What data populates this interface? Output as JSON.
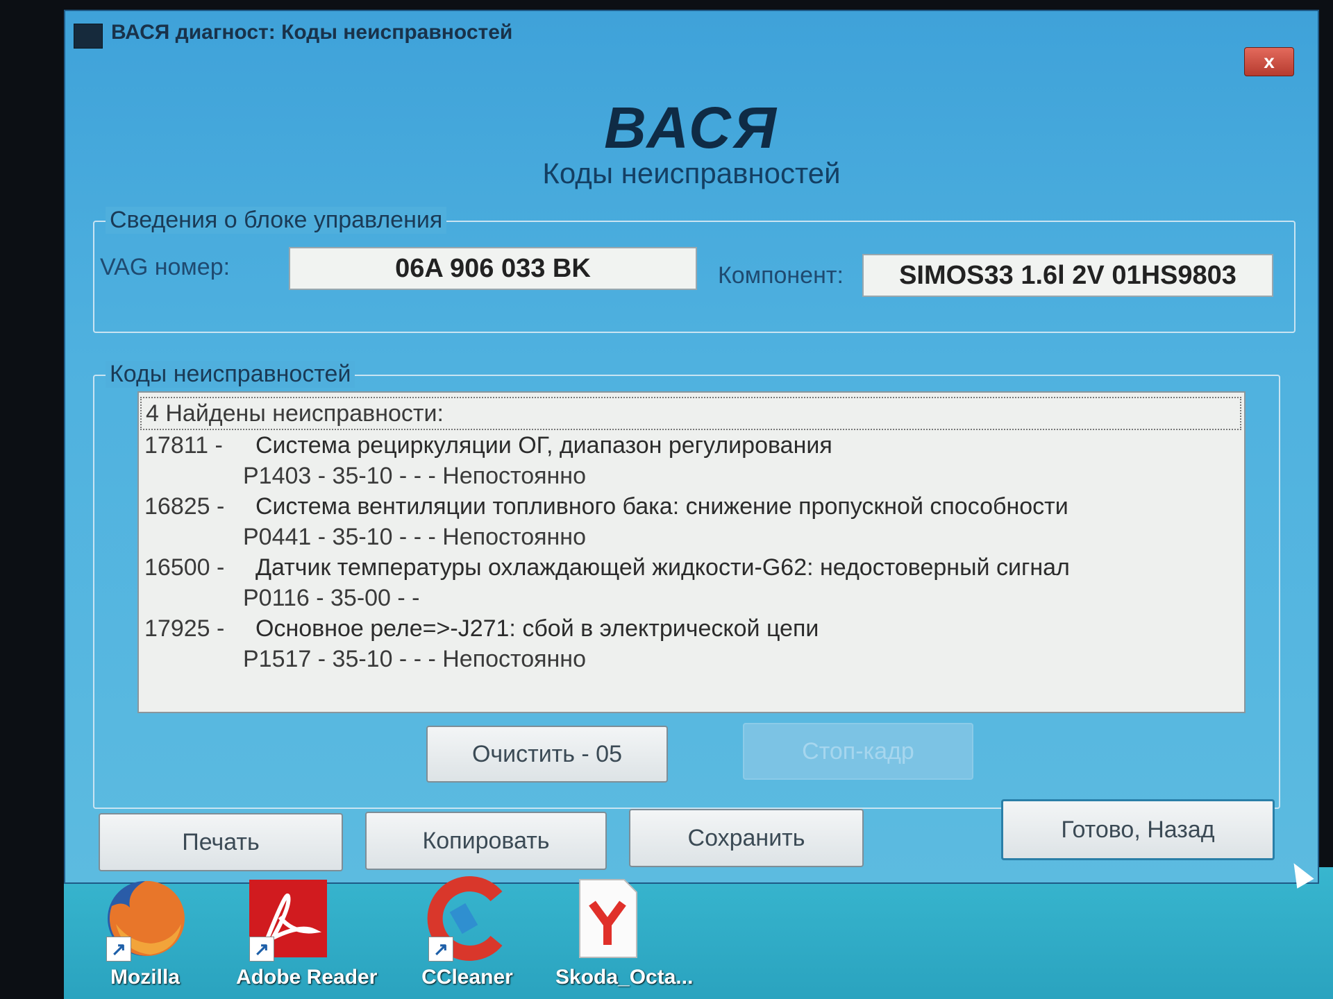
{
  "window": {
    "title": "ВАСЯ диагност: Коды неисправностей",
    "close_label": "x",
    "brand": "ВАСЯ",
    "subtitle": "Коды неисправностей"
  },
  "ecu_info": {
    "legend": "Сведения о блоке управления",
    "vag_label": "VAG номер:",
    "vag_value": "06A 906 033 BK",
    "component_label": "Компонент:",
    "component_value": "SIMOS33 1.6l 2V 01HS9803"
  },
  "faults": {
    "legend": "Коды неисправностей",
    "header": "4 Найдены неисправности:",
    "items": [
      {
        "code": "17811 -",
        "description": "Система рециркуляции ОГ, диапазон регулирования",
        "detail": "P1403 - 35-10 -   - - Непостоянно"
      },
      {
        "code": "16825 -",
        "description": "Система вентиляции топливного бака: снижение пропускной способности",
        "detail": "P0441 - 35-10 -   - - Непостоянно"
      },
      {
        "code": "16500 -",
        "description": "Датчик температуры охлаждающей жидкости-G62: недостоверный сигнал",
        "detail": "P0116 - 35-00 -   -"
      },
      {
        "code": "17925 -",
        "description": "Основное реле=>-J271: сбой в электрической цепи",
        "detail": "P1517 - 35-10 -   - - Непостоянно"
      }
    ],
    "clear_button": "Очистить - 05",
    "freeze_frame_button": "Стоп-кадр"
  },
  "bottom_buttons": {
    "print": "Печать",
    "copy": "Копировать",
    "save": "Сохранить",
    "done": "Готово, Назад"
  },
  "desktop_icons": [
    {
      "label": "Mozilla",
      "icon": "firefox-icon"
    },
    {
      "label": "Adobe Reader",
      "icon": "adobe-reader-icon"
    },
    {
      "label": "CCleaner",
      "icon": "ccleaner-icon"
    },
    {
      "label": "Skoda_Octa...",
      "icon": "yandex-browser-icon"
    }
  ]
}
